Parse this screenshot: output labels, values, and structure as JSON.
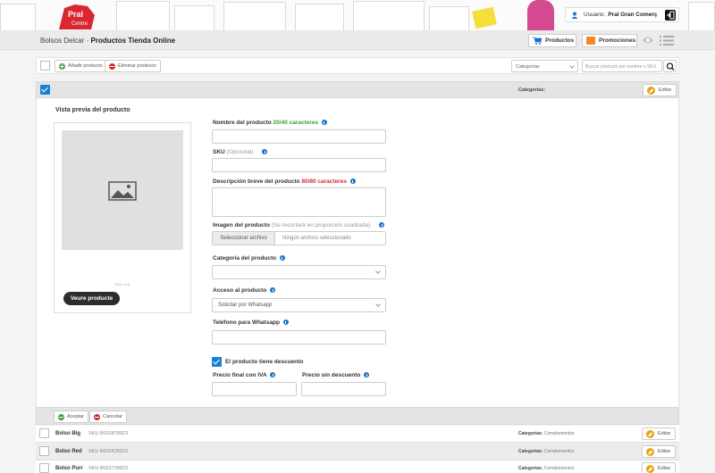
{
  "header": {
    "logo_text": "Pral Centre",
    "user_label": "Usuario:",
    "user_name": "Pral Gran Comerç"
  },
  "titlebar": {
    "breadcrumb_parent": "Bolsos Delcar",
    "breadcrumb_separator": "·",
    "breadcrumb_current": "Productos Tienda Online",
    "products_label": "Productos",
    "promotions_label": "Promociones"
  },
  "toolbar": {
    "add_label": "Añadir producto",
    "delete_label": "Eliminar producto",
    "category_select": "Categorías",
    "search_placeholder": "Buscar producto por nombre o SKU"
  },
  "editor": {
    "categories_label": "Categorías:",
    "edit_label": "Editar",
    "preview_title": "Vista previa del producto",
    "preview_placeholder_text": "SKU: null",
    "preview_button": "Veure producte",
    "name_label": "Nombre del producto",
    "name_counter": "20/40 caracteres",
    "sku_label": "SKU",
    "sku_optional": "(Opcional)",
    "desc_label": "Descripción breve del producto",
    "desc_counter": "80/80 caracteres",
    "image_label": "Imagen del producto",
    "image_hint": "(Se recortará en proporción cuadrada)",
    "file_button": "Seleccionar archivo",
    "file_none": "Ningún archivo seleccionado",
    "category_label": "Categoría del producto",
    "access_label": "Acceso al producto",
    "access_value": "Solicitar por Whatsapp",
    "phone_label": "Teléfono para Whatsapp",
    "discount_label": "El producto tiene descuento",
    "final_price_label": "Precio final con IVA",
    "no_discount_price_label": "Precio sin descuento",
    "accept_label": "Aceptar",
    "cancel_label": "Cancelar"
  },
  "products": [
    {
      "name": "Bolso Big",
      "sku": "SKU B001878923",
      "cat_label": "Categorías:",
      "category": "Complementos",
      "edit": "Editar"
    },
    {
      "name": "Bolso Red",
      "sku": "SKU B002428923",
      "cat_label": "Categorías:",
      "category": "Complementos",
      "edit": "Editar"
    },
    {
      "name": "Bolso Purr",
      "sku": "SKU B001728923",
      "cat_label": "Categorías:",
      "category": "Complementos",
      "edit": "Editar"
    }
  ],
  "colors": {
    "accent_blue": "#1b7fd1",
    "counter_ok": "#3ca03c",
    "counter_full": "#d9262f",
    "edit_icon": "#e8a514",
    "promo_icon": "#f08a24",
    "logo_red": "#d9262f"
  }
}
